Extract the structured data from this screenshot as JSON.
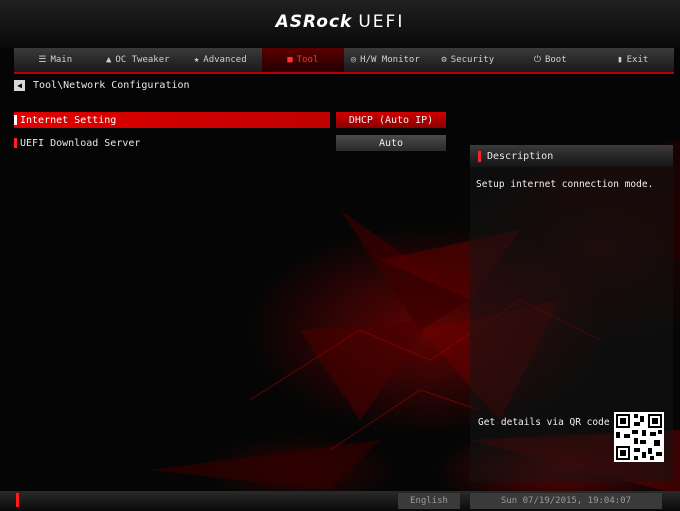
{
  "brand": {
    "logo_text": "ASRock",
    "suffix": "UEFI"
  },
  "tabs": [
    {
      "label": "Main",
      "icon": "list-icon",
      "active": false
    },
    {
      "label": "OC Tweaker",
      "icon": "rocket-icon",
      "active": false
    },
    {
      "label": "Advanced",
      "icon": "star-icon",
      "active": false
    },
    {
      "label": "Tool",
      "icon": "toolbox-icon",
      "active": true
    },
    {
      "label": "H/W Monitor",
      "icon": "monitor-icon",
      "active": false
    },
    {
      "label": "Security",
      "icon": "shield-icon",
      "active": false
    },
    {
      "label": "Boot",
      "icon": "power-icon",
      "active": false
    },
    {
      "label": "Exit",
      "icon": "exit-icon",
      "active": false
    }
  ],
  "breadcrumb": {
    "path": "Tool\\Network Configuration"
  },
  "settings": [
    {
      "label": "Internet Setting",
      "value": "DHCP (Auto IP)",
      "selected": true
    },
    {
      "label": "UEFI Download Server",
      "value": "Auto",
      "selected": false
    }
  ],
  "description": {
    "title": "Description",
    "text": "Setup internet connection mode.",
    "qr_text": "Get details via QR code"
  },
  "footer": {
    "language": "English",
    "datetime": "Sun 07/19/2015, 19:04:07"
  },
  "colors": {
    "accent": "#e00000",
    "background": "#050505"
  }
}
